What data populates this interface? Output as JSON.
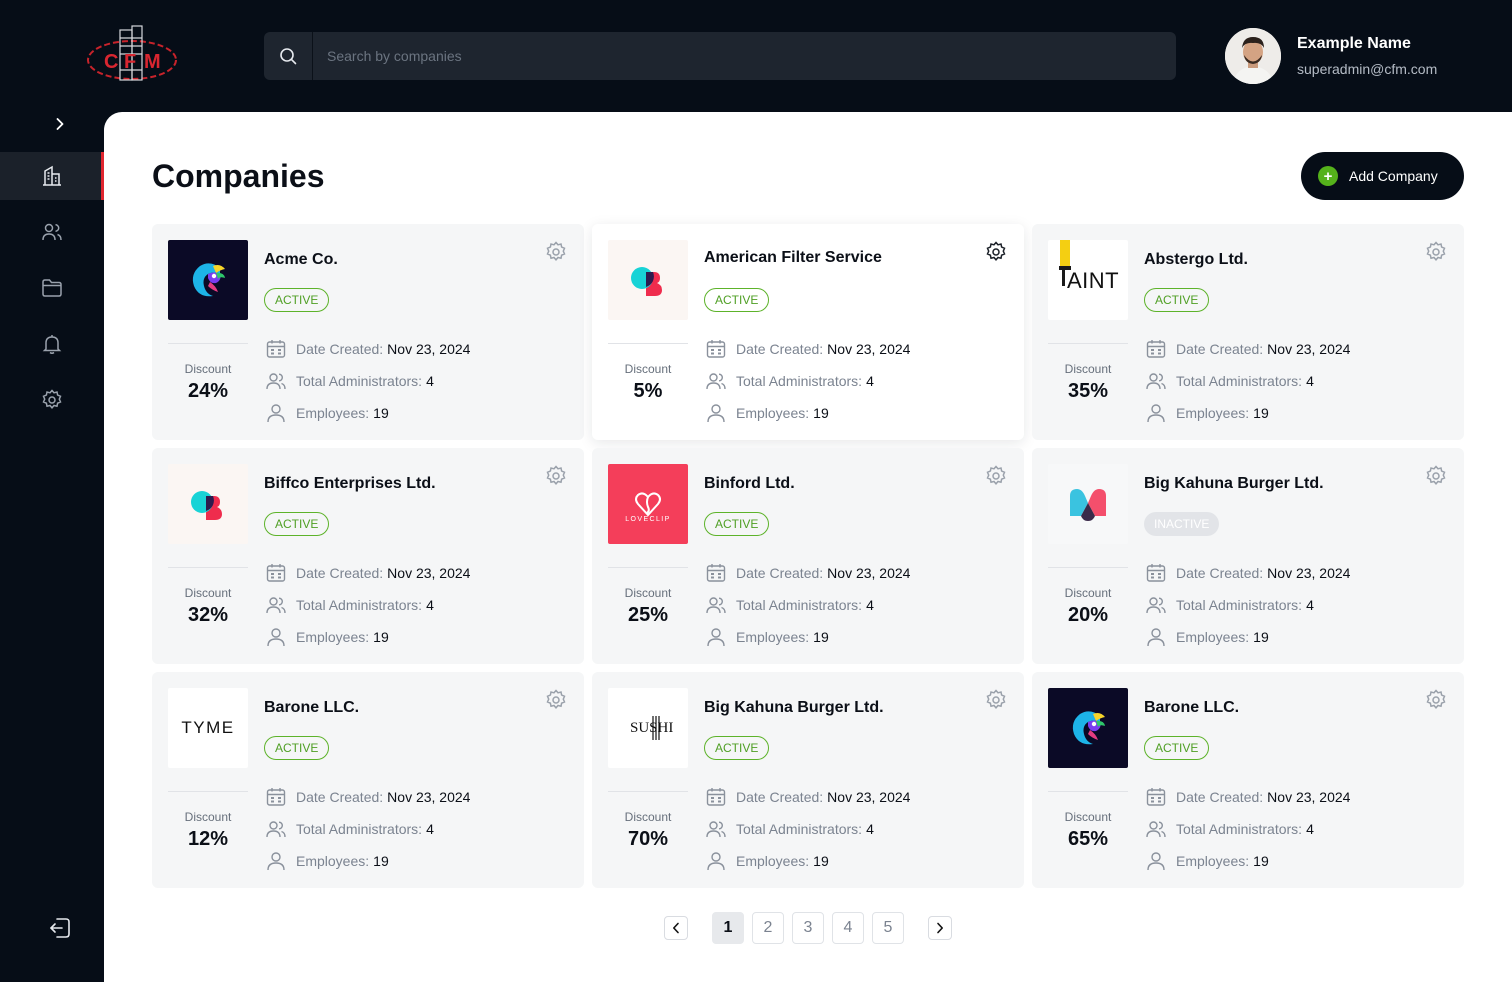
{
  "brand": {
    "logo_text": "CFM",
    "accent": "#e0262f",
    "success": "#55b21b"
  },
  "search": {
    "placeholder": "Search by companies"
  },
  "user": {
    "name": "Example Name",
    "email": "superadmin@cfm.com"
  },
  "sidebar": {
    "items": [
      {
        "icon": "building-icon",
        "active": true
      },
      {
        "icon": "users-icon",
        "active": false
      },
      {
        "icon": "folder-icon",
        "active": false
      },
      {
        "icon": "bell-icon",
        "active": false
      },
      {
        "icon": "settings-icon",
        "active": false
      }
    ],
    "logout_icon": "logout-icon"
  },
  "page": {
    "title": "Companies",
    "add_button": "Add Company",
    "plus_symbol": "+"
  },
  "labels": {
    "discount": "Discount",
    "date_created": "Date Created:",
    "total_admins": "Total Administrators:",
    "employees": "Employees:"
  },
  "companies": [
    {
      "name": "Acme Co.",
      "status": "ACTIVE",
      "discount": "24%",
      "date": "Nov 23, 2024",
      "admins": "4",
      "employees": "19",
      "logo": "chameleon"
    },
    {
      "name": "American Filter Service",
      "status": "ACTIVE",
      "discount": "5%",
      "date": "Nov 23, 2024",
      "admins": "4",
      "employees": "19",
      "logo": "b-mark"
    },
    {
      "name": "Abstergo Ltd.",
      "status": "ACTIVE",
      "discount": "35%",
      "date": "Nov 23, 2024",
      "admins": "4",
      "employees": "19",
      "logo": "paint",
      "logo_text": "AINT"
    },
    {
      "name": "Biffco Enterprises Ltd.",
      "status": "ACTIVE",
      "discount": "32%",
      "date": "Nov 23, 2024",
      "admins": "4",
      "employees": "19",
      "logo": "b-mark"
    },
    {
      "name": "Binford Ltd.",
      "status": "ACTIVE",
      "discount": "25%",
      "date": "Nov 23, 2024",
      "admins": "4",
      "employees": "19",
      "logo": "loveclip",
      "logo_text": "LOVECLIP"
    },
    {
      "name": "Big Kahuna Burger Ltd.",
      "status": "INACTIVE",
      "discount": "20%",
      "date": "Nov 23, 2024",
      "admins": "4",
      "employees": "19",
      "logo": "m-mark"
    },
    {
      "name": "Barone LLC.",
      "status": "ACTIVE",
      "discount": "12%",
      "date": "Nov 23, 2024",
      "admins": "4",
      "employees": "19",
      "logo": "tyme",
      "logo_text": "TYME"
    },
    {
      "name": "Big Kahuna Burger Ltd.",
      "status": "ACTIVE",
      "discount": "70%",
      "date": "Nov 23, 2024",
      "admins": "4",
      "employees": "19",
      "logo": "sushi",
      "logo_text": "SUSHI"
    },
    {
      "name": "Barone LLC.",
      "status": "ACTIVE",
      "discount": "65%",
      "date": "Nov 23, 2024",
      "admins": "4",
      "employees": "19",
      "logo": "chameleon"
    }
  ],
  "pagination": {
    "pages": [
      "1",
      "2",
      "3",
      "4",
      "5"
    ],
    "current": "1"
  }
}
